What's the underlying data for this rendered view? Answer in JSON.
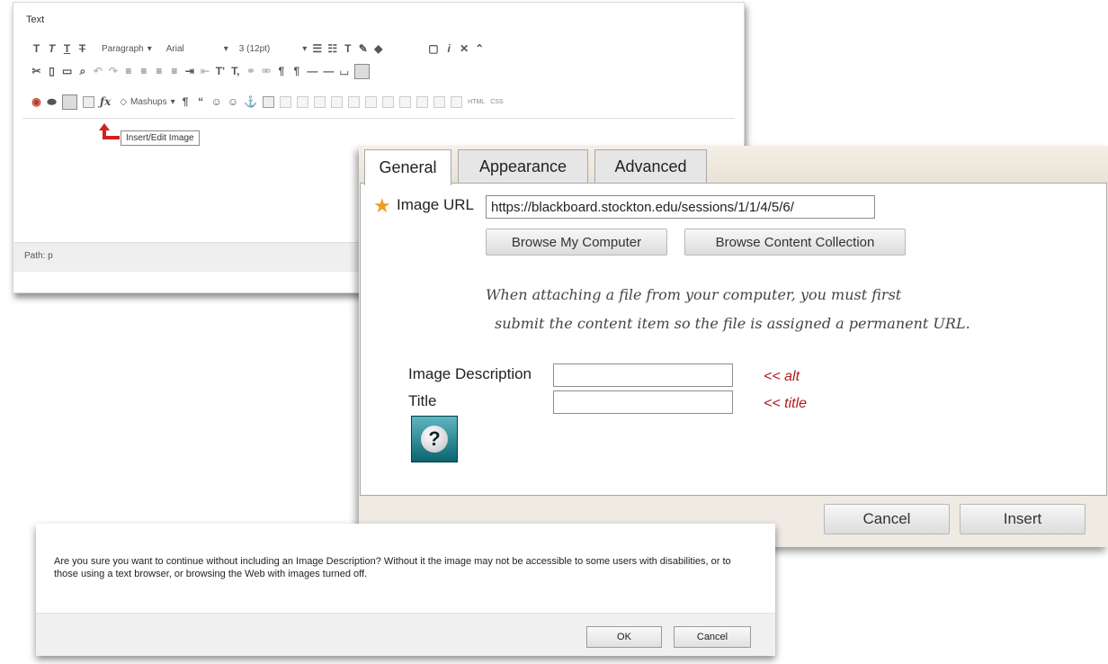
{
  "editor": {
    "label": "Text",
    "toolbar": {
      "format_dropdown": "Paragraph",
      "font_dropdown": "Arial",
      "size_dropdown": "3 (12pt)",
      "mashups_dropdown": "Mashups",
      "html_label": "HTML",
      "css_label": "CSS"
    },
    "tooltip": "Insert/Edit Image",
    "path_label": "Path: p"
  },
  "image_dialog": {
    "tabs": [
      "General",
      "Appearance",
      "Advanced"
    ],
    "active_tab": "General",
    "required_mark": "★",
    "url_label": "Image URL",
    "url_value": "https://blackboard.stockton.edu/sessions/1/1/4/5/6/",
    "browse_computer": "Browse My Computer",
    "browse_collection": "Browse Content Collection",
    "note_line1": "When attaching a file from your computer, you must first",
    "note_line2": "submit the content item so the file is assigned a permanent URL.",
    "description_label": "Image Description",
    "description_value": "",
    "title_label": "Title",
    "title_value": "",
    "alt_hint": "<<  alt",
    "title_hint": "<<  title",
    "help_glyph": "?",
    "cancel": "Cancel",
    "insert": "Insert"
  },
  "confirm_dialog": {
    "message": "Are you sure you want to continue without including an Image Description? Without it the image may not be accessible to some users with disabilities, or to those using a text browser, or browsing the Web with images turned off.",
    "ok": "OK",
    "cancel": "Cancel"
  },
  "colors": {
    "required_star": "#f29c1f",
    "hint_red": "#b01a1a",
    "arrow_red": "#d22020",
    "help_teal": "#0b6570"
  }
}
